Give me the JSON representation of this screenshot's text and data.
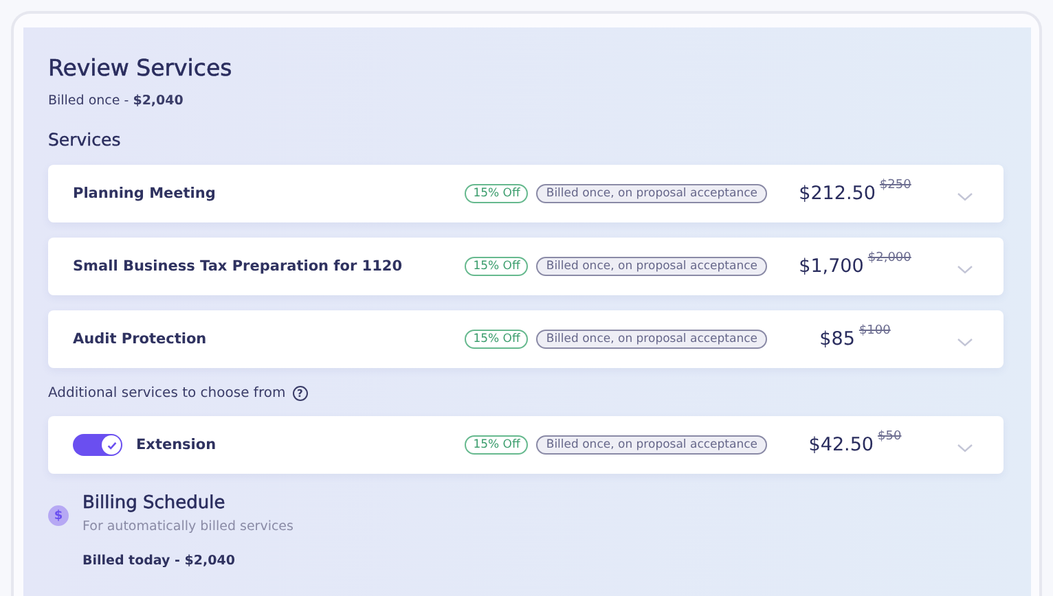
{
  "title": "Review Services",
  "summary": {
    "label": "Billed once - ",
    "amount": "$2,040"
  },
  "services_heading": "Services",
  "services": [
    {
      "name": "Planning Meeting",
      "discount": "15% Off",
      "billing": "Billed once, on proposal acceptance",
      "price": "$212.50",
      "old_price": "$250"
    },
    {
      "name": "Small Business Tax Preparation for 1120",
      "discount": "15% Off",
      "billing": "Billed once, on proposal acceptance",
      "price": "$1,700",
      "old_price": "$2,000"
    },
    {
      "name": "Audit Protection",
      "discount": "15% Off",
      "billing": "Billed once, on proposal acceptance",
      "price": "$85",
      "old_price": "$100"
    }
  ],
  "additional": {
    "heading": "Additional services to choose from",
    "help_icon": "?",
    "items": [
      {
        "name": "Extension",
        "on": true,
        "discount": "15% Off",
        "billing": "Billed once, on proposal acceptance",
        "price": "$42.50",
        "old_price": "$50"
      }
    ]
  },
  "billing_schedule": {
    "icon": "$",
    "title": "Billing Schedule",
    "subtitle": "For automatically billed services",
    "billed_today": "Billed today - $2,040"
  }
}
